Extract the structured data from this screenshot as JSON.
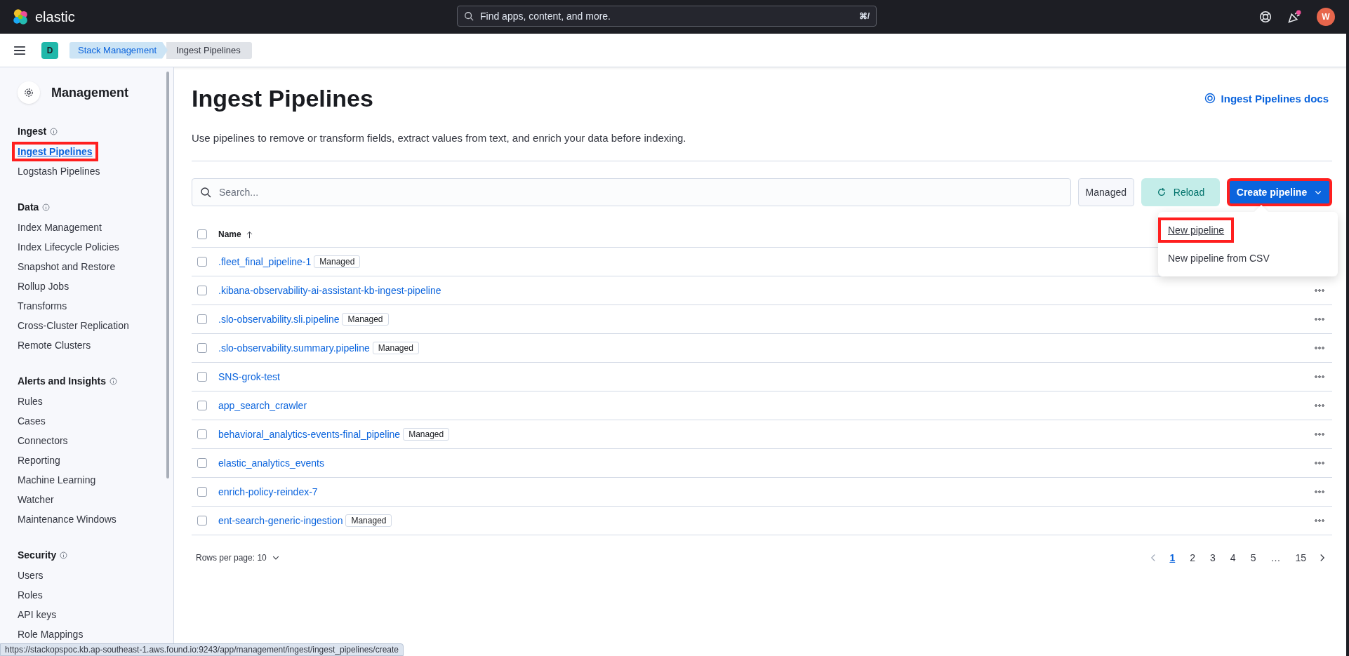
{
  "header": {
    "brand": "elastic",
    "search": {
      "placeholder": "Find apps, content, and more.",
      "shortcut": "⌘/"
    },
    "avatar": "W"
  },
  "breadcrumbs": {
    "space": "D",
    "items": [
      {
        "label": "Stack Management",
        "selected": false
      },
      {
        "label": "Ingest Pipelines",
        "selected": true
      }
    ]
  },
  "sidebar": {
    "title": "Management",
    "sections": [
      {
        "heading": "Ingest",
        "items": [
          {
            "label": "Ingest Pipelines",
            "selected": true,
            "highlighted": true
          },
          {
            "label": "Logstash Pipelines",
            "selected": false,
            "highlighted": false
          }
        ]
      },
      {
        "heading": "Data",
        "items": [
          {
            "label": "Index Management",
            "selected": false,
            "highlighted": false
          },
          {
            "label": "Index Lifecycle Policies",
            "selected": false,
            "highlighted": false
          },
          {
            "label": "Snapshot and Restore",
            "selected": false,
            "highlighted": false
          },
          {
            "label": "Rollup Jobs",
            "selected": false,
            "highlighted": false
          },
          {
            "label": "Transforms",
            "selected": false,
            "highlighted": false
          },
          {
            "label": "Cross-Cluster Replication",
            "selected": false,
            "highlighted": false
          },
          {
            "label": "Remote Clusters",
            "selected": false,
            "highlighted": false
          }
        ]
      },
      {
        "heading": "Alerts and Insights",
        "items": [
          {
            "label": "Rules",
            "selected": false,
            "highlighted": false
          },
          {
            "label": "Cases",
            "selected": false,
            "highlighted": false
          },
          {
            "label": "Connectors",
            "selected": false,
            "highlighted": false
          },
          {
            "label": "Reporting",
            "selected": false,
            "highlighted": false
          },
          {
            "label": "Machine Learning",
            "selected": false,
            "highlighted": false
          },
          {
            "label": "Watcher",
            "selected": false,
            "highlighted": false
          },
          {
            "label": "Maintenance Windows",
            "selected": false,
            "highlighted": false
          }
        ]
      },
      {
        "heading": "Security",
        "items": [
          {
            "label": "Users",
            "selected": false,
            "highlighted": false
          },
          {
            "label": "Roles",
            "selected": false,
            "highlighted": false
          },
          {
            "label": "API keys",
            "selected": false,
            "highlighted": false
          },
          {
            "label": "Role Mappings",
            "selected": false,
            "highlighted": false
          }
        ]
      }
    ]
  },
  "page": {
    "title": "Ingest Pipelines",
    "docs_link": "Ingest Pipelines docs",
    "description": "Use pipelines to remove or transform fields, extract values from text, and enrich your data before indexing."
  },
  "toolbar": {
    "search": {
      "placeholder": "Search..."
    },
    "filter": "Managed",
    "reload": "Reload",
    "create": {
      "label": "Create pipeline",
      "highlighted": true
    },
    "menu": [
      {
        "label": "New pipeline",
        "highlighted": true
      },
      {
        "label": "New pipeline from CSV",
        "highlighted": false
      }
    ]
  },
  "table": {
    "select_all_checked": false,
    "columns": [
      "Name"
    ],
    "rows": [
      {
        "name": ".fleet_final_pipeline-1",
        "badge": "Managed",
        "checked": false
      },
      {
        "name": ".kibana-observability-ai-assistant-kb-ingest-pipeline",
        "checked": false
      },
      {
        "name": ".slo-observability.sli.pipeline",
        "badge": "Managed",
        "checked": false
      },
      {
        "name": ".slo-observability.summary.pipeline",
        "badge": "Managed",
        "checked": false
      },
      {
        "name": "SNS-grok-test",
        "checked": false
      },
      {
        "name": "app_search_crawler",
        "checked": false
      },
      {
        "name": "behavioral_analytics-events-final_pipeline",
        "badge": "Managed",
        "checked": false
      },
      {
        "name": "elastic_analytics_events",
        "checked": false
      },
      {
        "name": "enrich-policy-reindex-7",
        "checked": false
      },
      {
        "name": "ent-search-generic-ingestion",
        "badge": "Managed",
        "checked": false
      }
    ]
  },
  "pagination": {
    "rows_per_page": "Rows per page: 10",
    "prev_disabled": true,
    "pages": [
      {
        "label": "1",
        "selected": true
      },
      {
        "label": "2",
        "selected": false
      },
      {
        "label": "3",
        "selected": false
      },
      {
        "label": "4",
        "selected": false
      },
      {
        "label": "5",
        "selected": false
      },
      {
        "label": "…",
        "selected": false
      },
      {
        "label": "15",
        "selected": false
      }
    ]
  },
  "status_url": "https://stackopspoc.kb.ap-southeast-1.aws.found.io:9243/app/management/ingest/ingest_pipelines/create"
}
